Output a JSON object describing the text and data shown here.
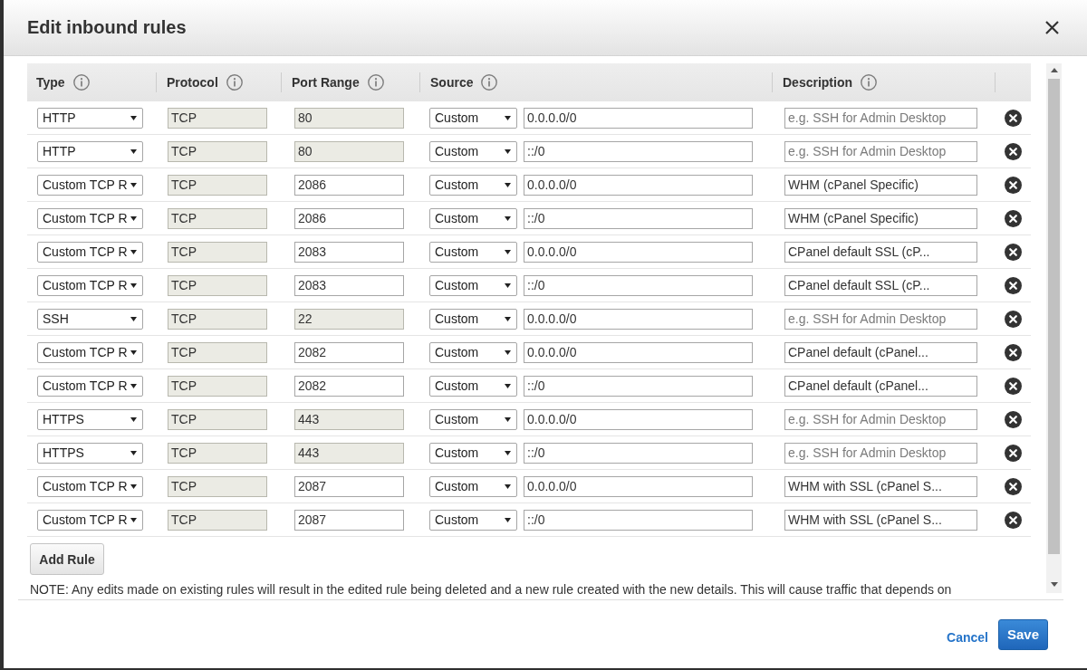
{
  "dialog": {
    "title": "Edit inbound rules"
  },
  "table": {
    "columns": [
      {
        "label": "Type"
      },
      {
        "label": "Protocol"
      },
      {
        "label": "Port Range"
      },
      {
        "label": "Source"
      },
      {
        "label": "Description"
      }
    ],
    "rows": [
      {
        "type": "HTTP",
        "protocol": {
          "value": "TCP",
          "disabled": true
        },
        "port_range": {
          "value": "80",
          "disabled": true
        },
        "source": {
          "type": "Custom",
          "value": "0.0.0.0/0"
        },
        "description": {
          "placeholder": "e.g. SSH for Admin Desktop"
        }
      },
      {
        "type": "HTTP",
        "protocol": {
          "value": "TCP",
          "disabled": true
        },
        "port_range": {
          "value": "80",
          "disabled": true
        },
        "source": {
          "type": "Custom",
          "value": "::/0"
        },
        "description": {
          "placeholder": "e.g. SSH for Admin Desktop"
        }
      },
      {
        "type": "Custom TCP R",
        "protocol": {
          "value": "TCP",
          "disabled": true
        },
        "port_range": {
          "value": "2086",
          "disabled": false
        },
        "source": {
          "type": "Custom",
          "value": "0.0.0.0/0"
        },
        "description": {
          "value": "WHM (cPanel Specific)"
        }
      },
      {
        "type": "Custom TCP R",
        "protocol": {
          "value": "TCP",
          "disabled": true
        },
        "port_range": {
          "value": "2086",
          "disabled": false
        },
        "source": {
          "type": "Custom",
          "value": "::/0"
        },
        "description": {
          "value": "WHM (cPanel Specific)"
        }
      },
      {
        "type": "Custom TCP R",
        "protocol": {
          "value": "TCP",
          "disabled": true
        },
        "port_range": {
          "value": "2083",
          "disabled": false
        },
        "source": {
          "type": "Custom",
          "value": "0.0.0.0/0"
        },
        "description": {
          "value": "CPanel default SSL (cP..."
        }
      },
      {
        "type": "Custom TCP R",
        "protocol": {
          "value": "TCP",
          "disabled": true
        },
        "port_range": {
          "value": "2083",
          "disabled": false
        },
        "source": {
          "type": "Custom",
          "value": "::/0"
        },
        "description": {
          "value": "CPanel default SSL (cP..."
        }
      },
      {
        "type": "SSH",
        "protocol": {
          "value": "TCP",
          "disabled": true
        },
        "port_range": {
          "value": "22",
          "disabled": true
        },
        "source": {
          "type": "Custom",
          "value": "0.0.0.0/0"
        },
        "description": {
          "placeholder": "e.g. SSH for Admin Desktop"
        }
      },
      {
        "type": "Custom TCP R",
        "protocol": {
          "value": "TCP",
          "disabled": true
        },
        "port_range": {
          "value": "2082",
          "disabled": false
        },
        "source": {
          "type": "Custom",
          "value": "0.0.0.0/0"
        },
        "description": {
          "value": "CPanel default (cPanel..."
        }
      },
      {
        "type": "Custom TCP R",
        "protocol": {
          "value": "TCP",
          "disabled": true
        },
        "port_range": {
          "value": "2082",
          "disabled": false
        },
        "source": {
          "type": "Custom",
          "value": "::/0"
        },
        "description": {
          "value": "CPanel default (cPanel..."
        }
      },
      {
        "type": "HTTPS",
        "protocol": {
          "value": "TCP",
          "disabled": true
        },
        "port_range": {
          "value": "443",
          "disabled": true
        },
        "source": {
          "type": "Custom",
          "value": "0.0.0.0/0"
        },
        "description": {
          "placeholder": "e.g. SSH for Admin Desktop"
        }
      },
      {
        "type": "HTTPS",
        "protocol": {
          "value": "TCP",
          "disabled": true
        },
        "port_range": {
          "value": "443",
          "disabled": true
        },
        "source": {
          "type": "Custom",
          "value": "::/0"
        },
        "description": {
          "placeholder": "e.g. SSH for Admin Desktop"
        }
      },
      {
        "type": "Custom TCP R",
        "protocol": {
          "value": "TCP",
          "disabled": true
        },
        "port_range": {
          "value": "2087",
          "disabled": false
        },
        "source": {
          "type": "Custom",
          "value": "0.0.0.0/0"
        },
        "description": {
          "value": "WHM with SSL (cPanel S..."
        }
      },
      {
        "type": "Custom TCP R",
        "protocol": {
          "value": "TCP",
          "disabled": true
        },
        "port_range": {
          "value": "2087",
          "disabled": false
        },
        "source": {
          "type": "Custom",
          "value": "::/0"
        },
        "description": {
          "value": "WHM with SSL (cPanel S..."
        }
      }
    ]
  },
  "add_rule_button": "Add Rule",
  "note": "NOTE: Any edits made on existing rules will result in the edited rule being deleted and a new rule created with the new details. This will cause traffic that depends on",
  "footer": {
    "cancel": "Cancel",
    "save": "Save"
  }
}
